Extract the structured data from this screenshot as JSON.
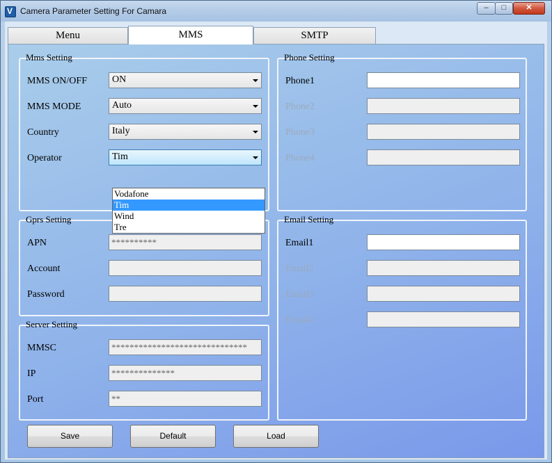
{
  "window": {
    "title": "Camera Parameter Setting For  Camara",
    "minimize_glyph": "–",
    "maximize_glyph": "□",
    "close_glyph": "✕"
  },
  "tabs": [
    {
      "label": "Menu"
    },
    {
      "label": "MMS"
    },
    {
      "label": "SMTP"
    }
  ],
  "mms_setting": {
    "title": "Mms Setting",
    "mms_onoff_label": "MMS ON/OFF",
    "mms_onoff_value": "ON",
    "mms_mode_label": "MMS MODE",
    "mms_mode_value": "Auto",
    "country_label": "Country",
    "country_value": "Italy",
    "operator_label": "Operator",
    "operator_value": "Tim",
    "operator_options": [
      "Vodafone",
      "Tim",
      "Wind",
      "Tre"
    ]
  },
  "phone_setting": {
    "title": "Phone Setting",
    "phone1_label": "Phone1",
    "phone2_label": "Phone2",
    "phone3_label": "Phone3",
    "phone4_label": "Phone4",
    "phone1_value": "",
    "phone2_value": "",
    "phone3_value": "",
    "phone4_value": ""
  },
  "gprs_setting": {
    "title": "Gprs Setting",
    "apn_label": "APN",
    "apn_value": "**********",
    "account_label": "Account",
    "account_value": "",
    "password_label": "Password",
    "password_value": ""
  },
  "email_setting": {
    "title": "Email Setting",
    "email1_label": "Email1",
    "email2_label": "Email2",
    "email3_label": "Email3",
    "email4_label": "Email4",
    "email1_value": "",
    "email2_value": "",
    "email3_value": "",
    "email4_value": ""
  },
  "server_setting": {
    "title": "Server Setting",
    "mmsc_label": "MMSC",
    "mmsc_value": "******************************",
    "ip_label": "IP",
    "ip_value": "**************",
    "port_label": "Port",
    "port_value": "**"
  },
  "buttons": {
    "save": "Save",
    "default": "Default",
    "load": "Load"
  }
}
